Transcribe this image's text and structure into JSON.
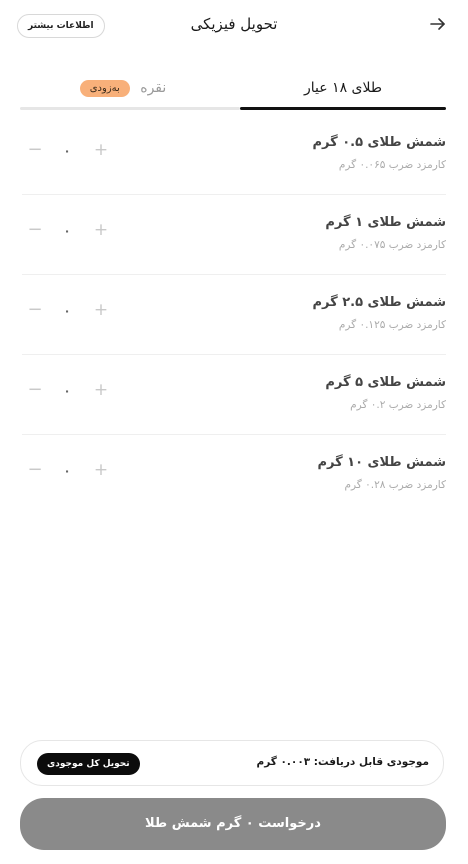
{
  "header": {
    "title": "تحویل فیزیکی",
    "more_info": "اطلاعات بیشتر",
    "back_icon": "arrow-right-icon"
  },
  "tabs": {
    "gold": "طلای ۱۸ عیار",
    "silver": "نقره",
    "silver_badge": "به‌زودی"
  },
  "items": [
    {
      "name": "شمش طلای ۰.۵ گرم",
      "fee": "کارمزد ضرب ۰.۰۶۵ گرم",
      "qty": "۰"
    },
    {
      "name": "شمش طلای ۱ گرم",
      "fee": "کارمزد ضرب ۰.۰۷۵ گرم",
      "qty": "۰"
    },
    {
      "name": "شمش طلای ۲.۵ گرم",
      "fee": "کارمزد ضرب ۰.۱۲۵ گرم",
      "qty": "۰"
    },
    {
      "name": "شمش طلای ۵ گرم",
      "fee": "کارمزد ضرب ۰.۲ گرم",
      "qty": "۰"
    },
    {
      "name": "شمش طلای ۱۰ گرم",
      "fee": "کارمزد ضرب ۰.۲۸ گرم",
      "qty": "۰"
    }
  ],
  "stepper": {
    "minus": "−",
    "plus": "+"
  },
  "balance": {
    "text": "موجودی قابل دریافت: ۰.۰۰۳ گرم",
    "deliver_all": "تحویل کل موجودی"
  },
  "request_button": "درخواست ۰ گرم شمش طلا",
  "colors": {
    "accent_dark": "#111111",
    "badge": "#f8b07a",
    "button_disabled": "#8a8a8a"
  }
}
